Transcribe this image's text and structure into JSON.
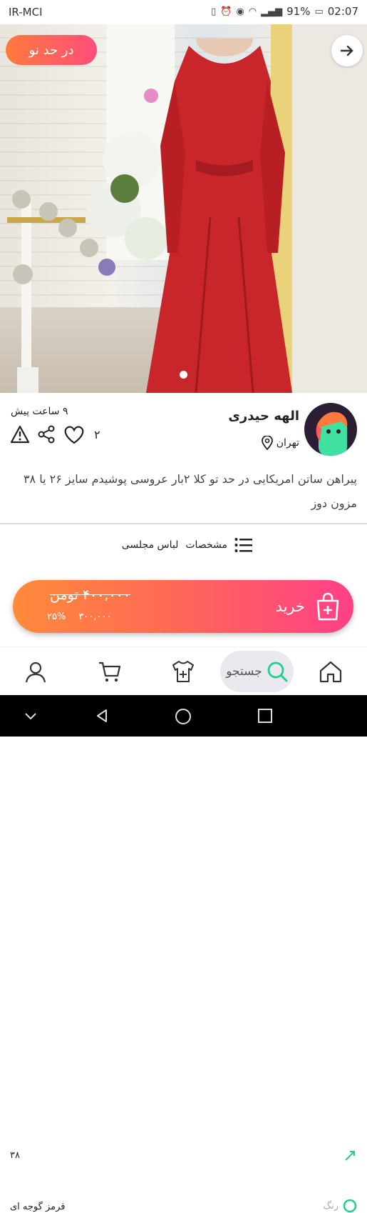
{
  "status_bar": {
    "carrier": "IR-MCI",
    "battery": "91%",
    "time": "02:07"
  },
  "listing": {
    "badge": "در حد نو",
    "seller_name": "الهه حیدری",
    "city": "تهران",
    "posted": "۹ ساعت پیش",
    "likes": "۲",
    "description": "پیراهن ساتن امریکایی در حد تو کلا ۲بار عروسی پوشیدم سایز ۲۶ یا ۳۸ مزون دوز",
    "spec_label": "مشخصات",
    "category": "لباس مجلسی",
    "size_partial": "۳۸",
    "color_label": "رنگ",
    "color_value": "قرمز گوجه ای"
  },
  "purchase": {
    "old_price": "۴۰۰,۰۰۰ تومن",
    "discount": "۲۵%",
    "new_price": "۳۰۰,۰۰۰",
    "buy_label": "خرید"
  },
  "nav": {
    "search_label": "جستجو"
  },
  "colors": {
    "accent_orange": "#ff7a3d",
    "accent_pink": "#ff3f88",
    "success_green": "#1fd18a",
    "dress_red": "#c8262a"
  }
}
